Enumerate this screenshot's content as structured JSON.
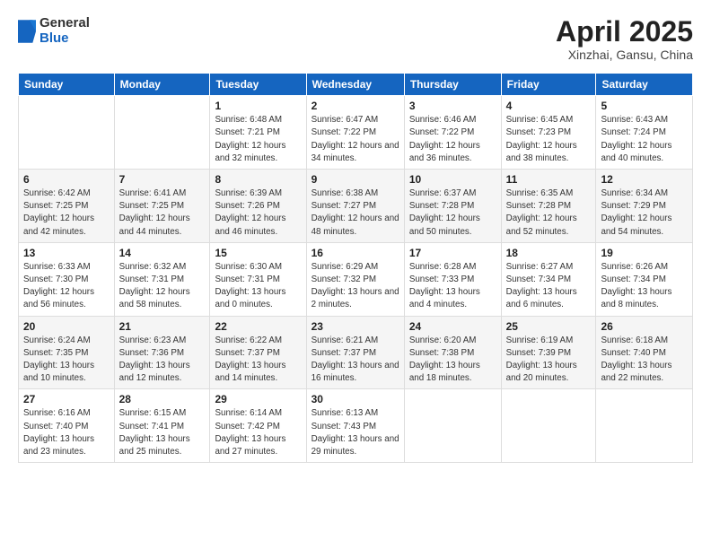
{
  "header": {
    "logo_general": "General",
    "logo_blue": "Blue",
    "title": "April 2025",
    "location": "Xinzhai, Gansu, China"
  },
  "days_of_week": [
    "Sunday",
    "Monday",
    "Tuesday",
    "Wednesday",
    "Thursday",
    "Friday",
    "Saturday"
  ],
  "weeks": [
    [
      {
        "day": "",
        "info": ""
      },
      {
        "day": "",
        "info": ""
      },
      {
        "day": "1",
        "info": "Sunrise: 6:48 AM\nSunset: 7:21 PM\nDaylight: 12 hours\nand 32 minutes."
      },
      {
        "day": "2",
        "info": "Sunrise: 6:47 AM\nSunset: 7:22 PM\nDaylight: 12 hours\nand 34 minutes."
      },
      {
        "day": "3",
        "info": "Sunrise: 6:46 AM\nSunset: 7:22 PM\nDaylight: 12 hours\nand 36 minutes."
      },
      {
        "day": "4",
        "info": "Sunrise: 6:45 AM\nSunset: 7:23 PM\nDaylight: 12 hours\nand 38 minutes."
      },
      {
        "day": "5",
        "info": "Sunrise: 6:43 AM\nSunset: 7:24 PM\nDaylight: 12 hours\nand 40 minutes."
      }
    ],
    [
      {
        "day": "6",
        "info": "Sunrise: 6:42 AM\nSunset: 7:25 PM\nDaylight: 12 hours\nand 42 minutes."
      },
      {
        "day": "7",
        "info": "Sunrise: 6:41 AM\nSunset: 7:25 PM\nDaylight: 12 hours\nand 44 minutes."
      },
      {
        "day": "8",
        "info": "Sunrise: 6:39 AM\nSunset: 7:26 PM\nDaylight: 12 hours\nand 46 minutes."
      },
      {
        "day": "9",
        "info": "Sunrise: 6:38 AM\nSunset: 7:27 PM\nDaylight: 12 hours\nand 48 minutes."
      },
      {
        "day": "10",
        "info": "Sunrise: 6:37 AM\nSunset: 7:28 PM\nDaylight: 12 hours\nand 50 minutes."
      },
      {
        "day": "11",
        "info": "Sunrise: 6:35 AM\nSunset: 7:28 PM\nDaylight: 12 hours\nand 52 minutes."
      },
      {
        "day": "12",
        "info": "Sunrise: 6:34 AM\nSunset: 7:29 PM\nDaylight: 12 hours\nand 54 minutes."
      }
    ],
    [
      {
        "day": "13",
        "info": "Sunrise: 6:33 AM\nSunset: 7:30 PM\nDaylight: 12 hours\nand 56 minutes."
      },
      {
        "day": "14",
        "info": "Sunrise: 6:32 AM\nSunset: 7:31 PM\nDaylight: 12 hours\nand 58 minutes."
      },
      {
        "day": "15",
        "info": "Sunrise: 6:30 AM\nSunset: 7:31 PM\nDaylight: 13 hours\nand 0 minutes."
      },
      {
        "day": "16",
        "info": "Sunrise: 6:29 AM\nSunset: 7:32 PM\nDaylight: 13 hours\nand 2 minutes."
      },
      {
        "day": "17",
        "info": "Sunrise: 6:28 AM\nSunset: 7:33 PM\nDaylight: 13 hours\nand 4 minutes."
      },
      {
        "day": "18",
        "info": "Sunrise: 6:27 AM\nSunset: 7:34 PM\nDaylight: 13 hours\nand 6 minutes."
      },
      {
        "day": "19",
        "info": "Sunrise: 6:26 AM\nSunset: 7:34 PM\nDaylight: 13 hours\nand 8 minutes."
      }
    ],
    [
      {
        "day": "20",
        "info": "Sunrise: 6:24 AM\nSunset: 7:35 PM\nDaylight: 13 hours\nand 10 minutes."
      },
      {
        "day": "21",
        "info": "Sunrise: 6:23 AM\nSunset: 7:36 PM\nDaylight: 13 hours\nand 12 minutes."
      },
      {
        "day": "22",
        "info": "Sunrise: 6:22 AM\nSunset: 7:37 PM\nDaylight: 13 hours\nand 14 minutes."
      },
      {
        "day": "23",
        "info": "Sunrise: 6:21 AM\nSunset: 7:37 PM\nDaylight: 13 hours\nand 16 minutes."
      },
      {
        "day": "24",
        "info": "Sunrise: 6:20 AM\nSunset: 7:38 PM\nDaylight: 13 hours\nand 18 minutes."
      },
      {
        "day": "25",
        "info": "Sunrise: 6:19 AM\nSunset: 7:39 PM\nDaylight: 13 hours\nand 20 minutes."
      },
      {
        "day": "26",
        "info": "Sunrise: 6:18 AM\nSunset: 7:40 PM\nDaylight: 13 hours\nand 22 minutes."
      }
    ],
    [
      {
        "day": "27",
        "info": "Sunrise: 6:16 AM\nSunset: 7:40 PM\nDaylight: 13 hours\nand 23 minutes."
      },
      {
        "day": "28",
        "info": "Sunrise: 6:15 AM\nSunset: 7:41 PM\nDaylight: 13 hours\nand 25 minutes."
      },
      {
        "day": "29",
        "info": "Sunrise: 6:14 AM\nSunset: 7:42 PM\nDaylight: 13 hours\nand 27 minutes."
      },
      {
        "day": "30",
        "info": "Sunrise: 6:13 AM\nSunset: 7:43 PM\nDaylight: 13 hours\nand 29 minutes."
      },
      {
        "day": "",
        "info": ""
      },
      {
        "day": "",
        "info": ""
      },
      {
        "day": "",
        "info": ""
      }
    ]
  ]
}
